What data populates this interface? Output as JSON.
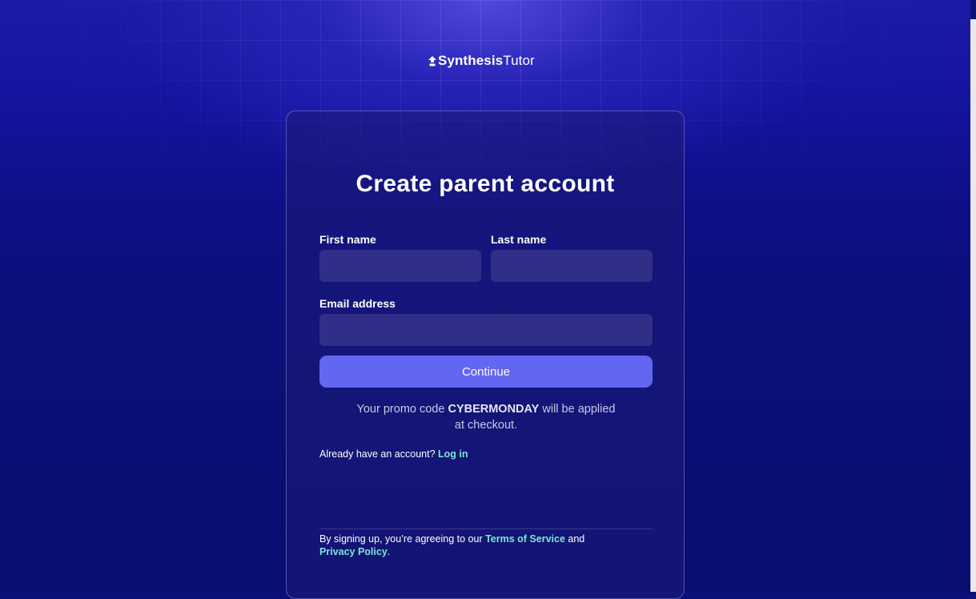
{
  "brand": {
    "name_bold": "Synthesis",
    "name_light": "Tutor",
    "icon": "up-arrow-logo-icon"
  },
  "form": {
    "title": "Create parent account",
    "first_name_label": "First name",
    "first_name_value": "",
    "first_name_placeholder": "",
    "last_name_label": "Last name",
    "last_name_value": "",
    "last_name_placeholder": "",
    "email_label": "Email address",
    "email_value": "",
    "email_placeholder": "",
    "continue_label": "Continue"
  },
  "promo": {
    "prefix": "Your promo code ",
    "code": "CYBERMONDAY",
    "suffix_line1": " will be applied",
    "suffix_line2": "at checkout."
  },
  "login": {
    "prompt": "Already have an account?",
    "link_label": "Log in"
  },
  "terms": {
    "prefix": "By signing up, you’re agreeing to our ",
    "tos_label": "Terms of Service",
    "middle": " and",
    "privacy_label": "Privacy Policy",
    "suffix": "."
  },
  "colors": {
    "background": "#0b0f78",
    "card": "#1c1c78",
    "input": "#2f2f88",
    "accent": "#6366f1",
    "link": "#7ee6d6"
  }
}
